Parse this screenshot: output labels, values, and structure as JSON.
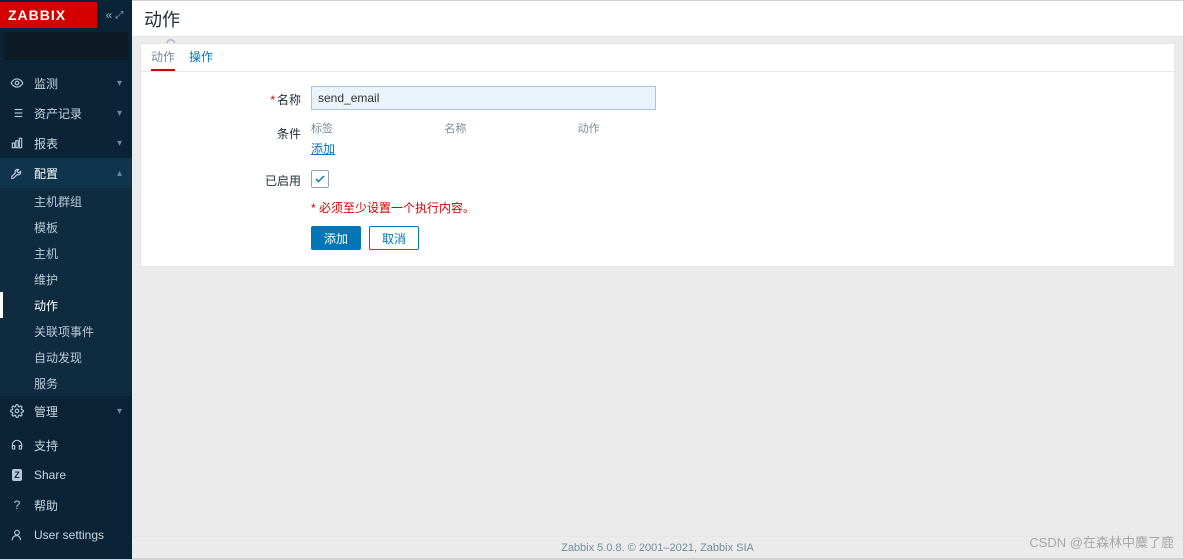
{
  "brand": "ZABBIX",
  "search": {
    "placeholder": ""
  },
  "nav": {
    "monitor": "监测",
    "inventory": "资产记录",
    "reports": "报表",
    "config": "配置",
    "admin": "管理",
    "support": "支持",
    "share": "Share",
    "help": "帮助",
    "user_settings": "User settings"
  },
  "subnav": {
    "host_groups": "主机群组",
    "templates": "模板",
    "hosts": "主机",
    "maintenance": "维护",
    "actions": "动作",
    "event_correlation": "关联项事件",
    "discovery": "自动发现",
    "services": "服务"
  },
  "page_title": "动作",
  "tabs": {
    "action": "动作",
    "operation": "操作"
  },
  "form": {
    "name_label": "名称",
    "name_value": "send_email",
    "condition_label": "条件",
    "cond_head_tag": "标签",
    "cond_head_name": "名称",
    "cond_head_action": "动作",
    "add_link": "添加",
    "enabled_label": "已启用",
    "error_msg": "必须至少设置一个执行内容。",
    "submit": "添加",
    "cancel": "取消"
  },
  "footer": "Zabbix 5.0.8. © 2001–2021, Zabbix SIA",
  "watermark": "CSDN @在森林中麋了鹿"
}
